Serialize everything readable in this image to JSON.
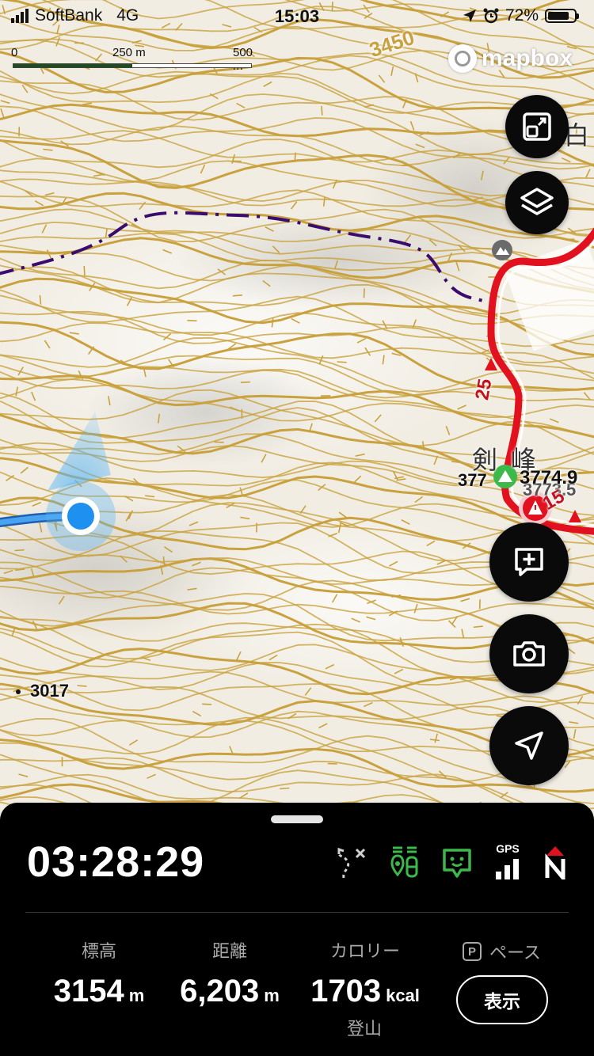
{
  "status_bar": {
    "carrier": "SoftBank",
    "network": "4G",
    "time": "15:03",
    "battery": "72%"
  },
  "map": {
    "scale_labels": [
      "0",
      "250 m",
      "500 m"
    ],
    "attribution": "mapbox",
    "contour_label": "3450",
    "peak_name": "剣 峰",
    "elevation_label_peak": "3774.9",
    "elevation_label_partial": "377",
    "elevation_label_back": "3773.5",
    "spot_height": "3017",
    "route_marker_a": "25",
    "route_marker_b": "15",
    "place_label_cut": "白"
  },
  "panel": {
    "elapsed_time": "03:28:29",
    "gps_label": "GPS",
    "stats": [
      {
        "label": "標高",
        "value": "3154",
        "unit": "m"
      },
      {
        "label": "距離",
        "value": "6,203",
        "unit": "m"
      },
      {
        "label": "カロリー",
        "value": "1703",
        "unit": "kcal"
      }
    ],
    "activity_mode": "登山",
    "pace_badge": "P",
    "pace_label": "ペース",
    "show_button": "表示"
  },
  "colors": {
    "contour": "#c9a23f",
    "route_red": "#e2111f",
    "track_blue": "#1e88e5",
    "boundary_purple": "#3a0c6e",
    "panel_bg": "#000000",
    "accent_green": "#3db84a"
  },
  "icons": [
    "route-off-icon",
    "companions-icon",
    "chat-icon",
    "gps-signal-icon",
    "compass-north-icon",
    "fullscreen-icon",
    "layers-icon",
    "add-note-icon",
    "camera-icon",
    "locate-icon"
  ]
}
